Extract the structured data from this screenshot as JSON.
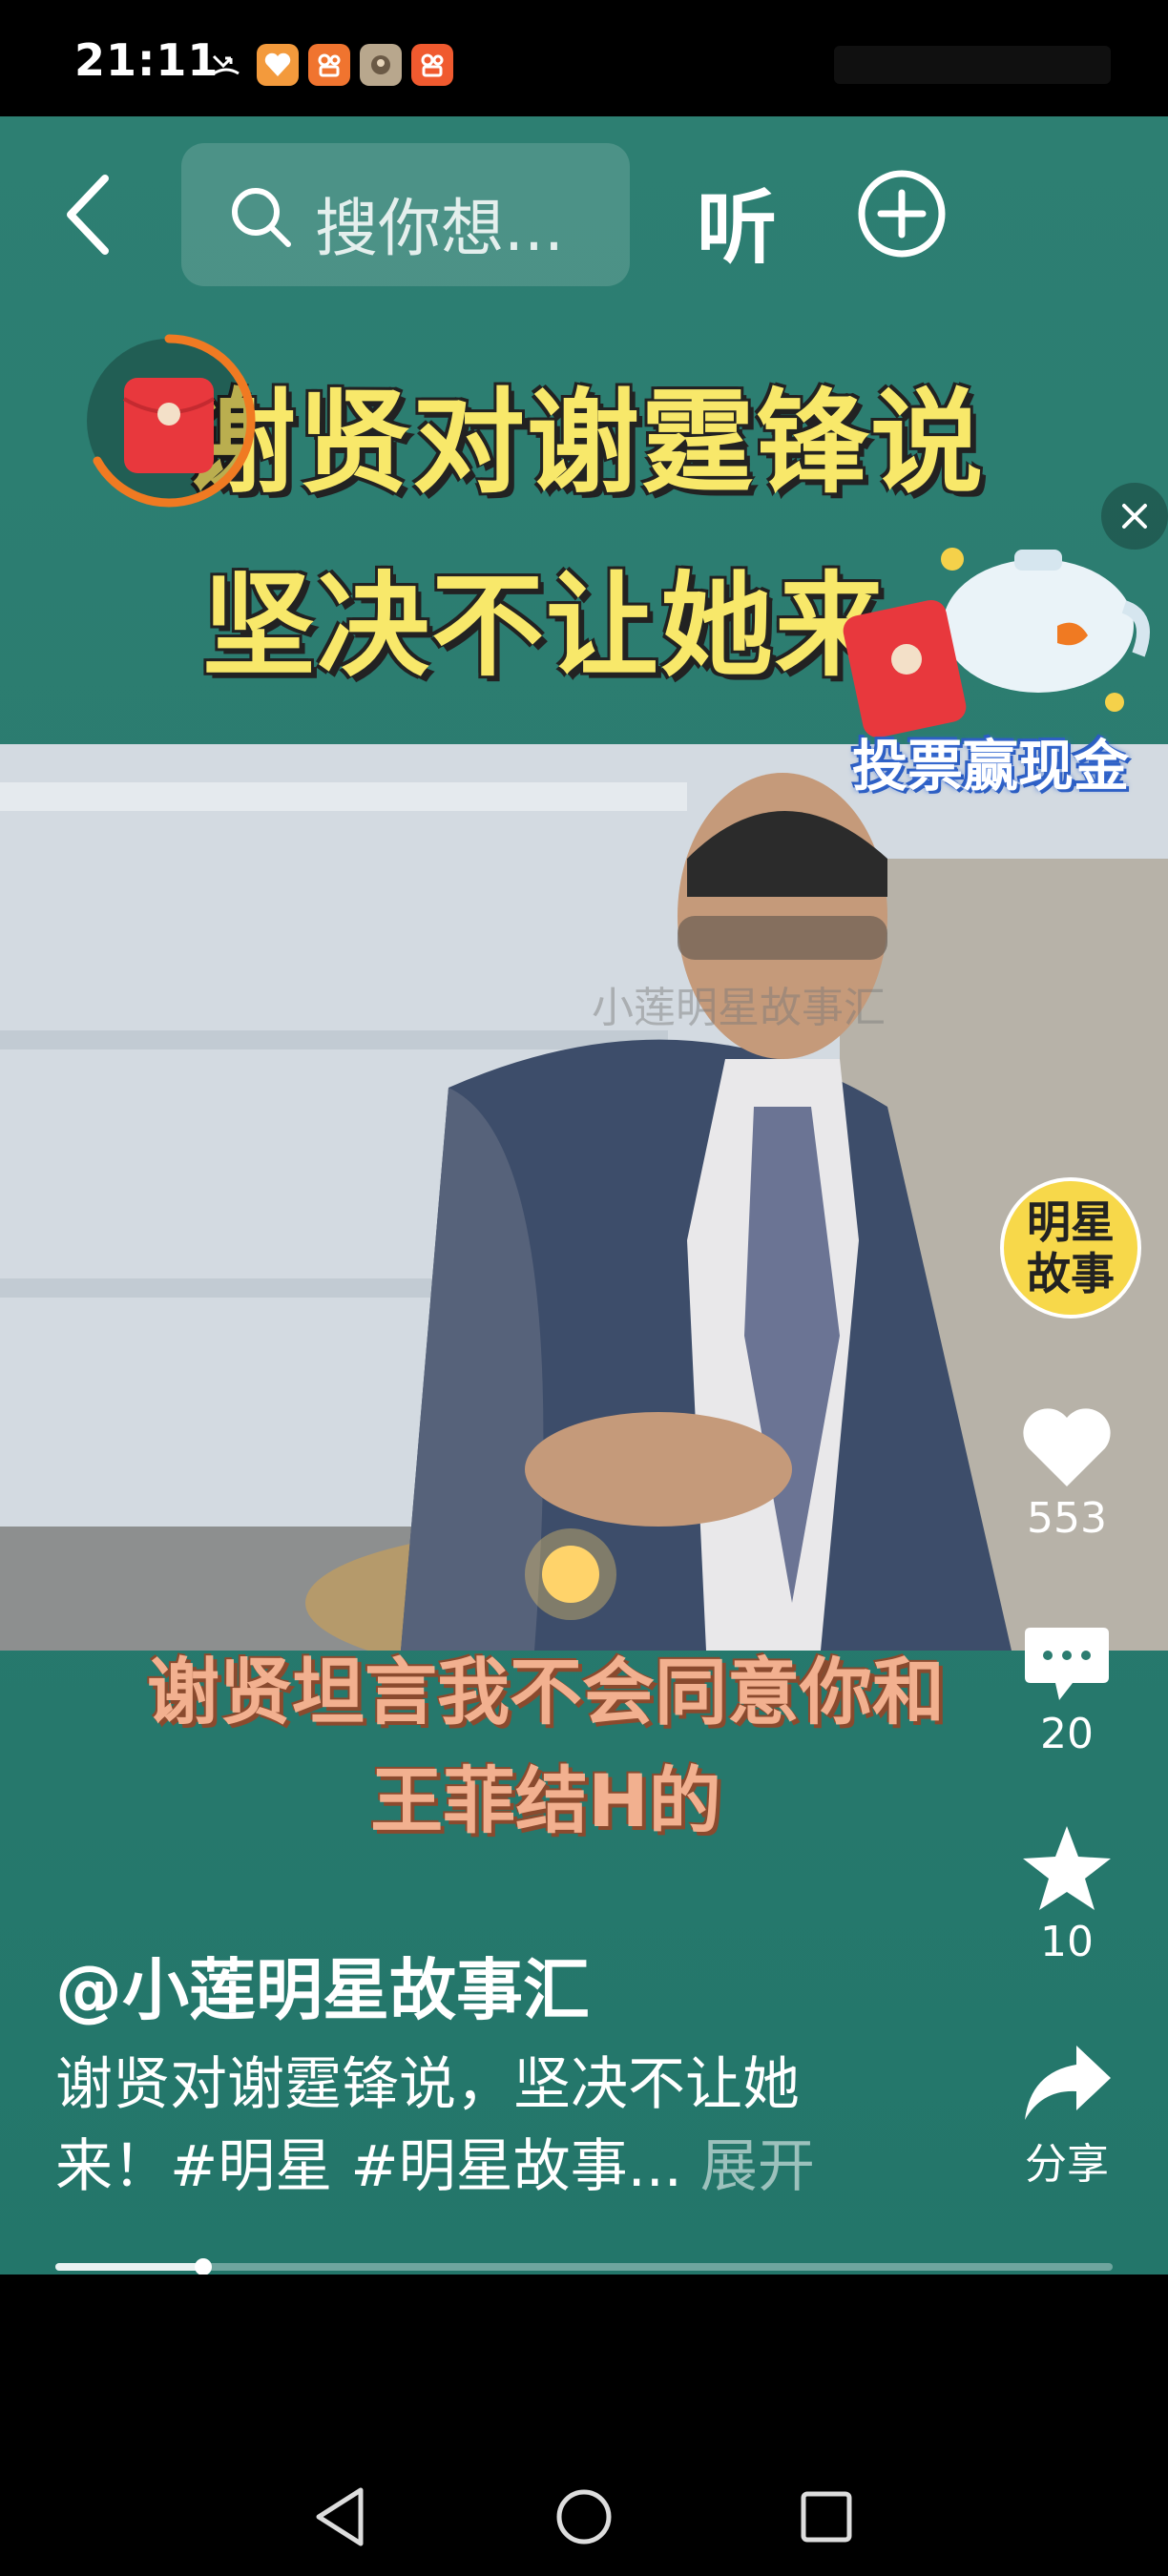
{
  "status_bar": {
    "time": "21:11"
  },
  "top_bar": {
    "search_placeholder": "搜你想...",
    "listen_label": "听"
  },
  "video": {
    "title_line_1": "谢贤对谢霆锋说",
    "title_line_2": "坚决不让她来",
    "subtitle_line_1": "谢贤坦言我不会同意你和",
    "subtitle_line_2": "王菲结H的",
    "watermark": "小莲明星故事汇"
  },
  "vote_widget": {
    "label": "投票赢现金"
  },
  "side_rail": {
    "channel_badge": "明星故事",
    "like_count": "553",
    "comment_count": "20",
    "favorite_count": "10",
    "share_label": "分享"
  },
  "post": {
    "author": "@小莲明星故事汇",
    "description_line_1": "谢贤对谢霆锋说，坚决不让她",
    "description_line_2": "来！#明星 #明星故事...",
    "expand_label": "展开"
  },
  "progress": {
    "fraction": 0.14
  },
  "colors": {
    "background_teal": "#2b7c70",
    "title_yellow": "#f8e86a",
    "subtitle_peach": "#f2b08f",
    "badge_yellow": "#f7d84a",
    "timer_orange": "#f07a22"
  }
}
